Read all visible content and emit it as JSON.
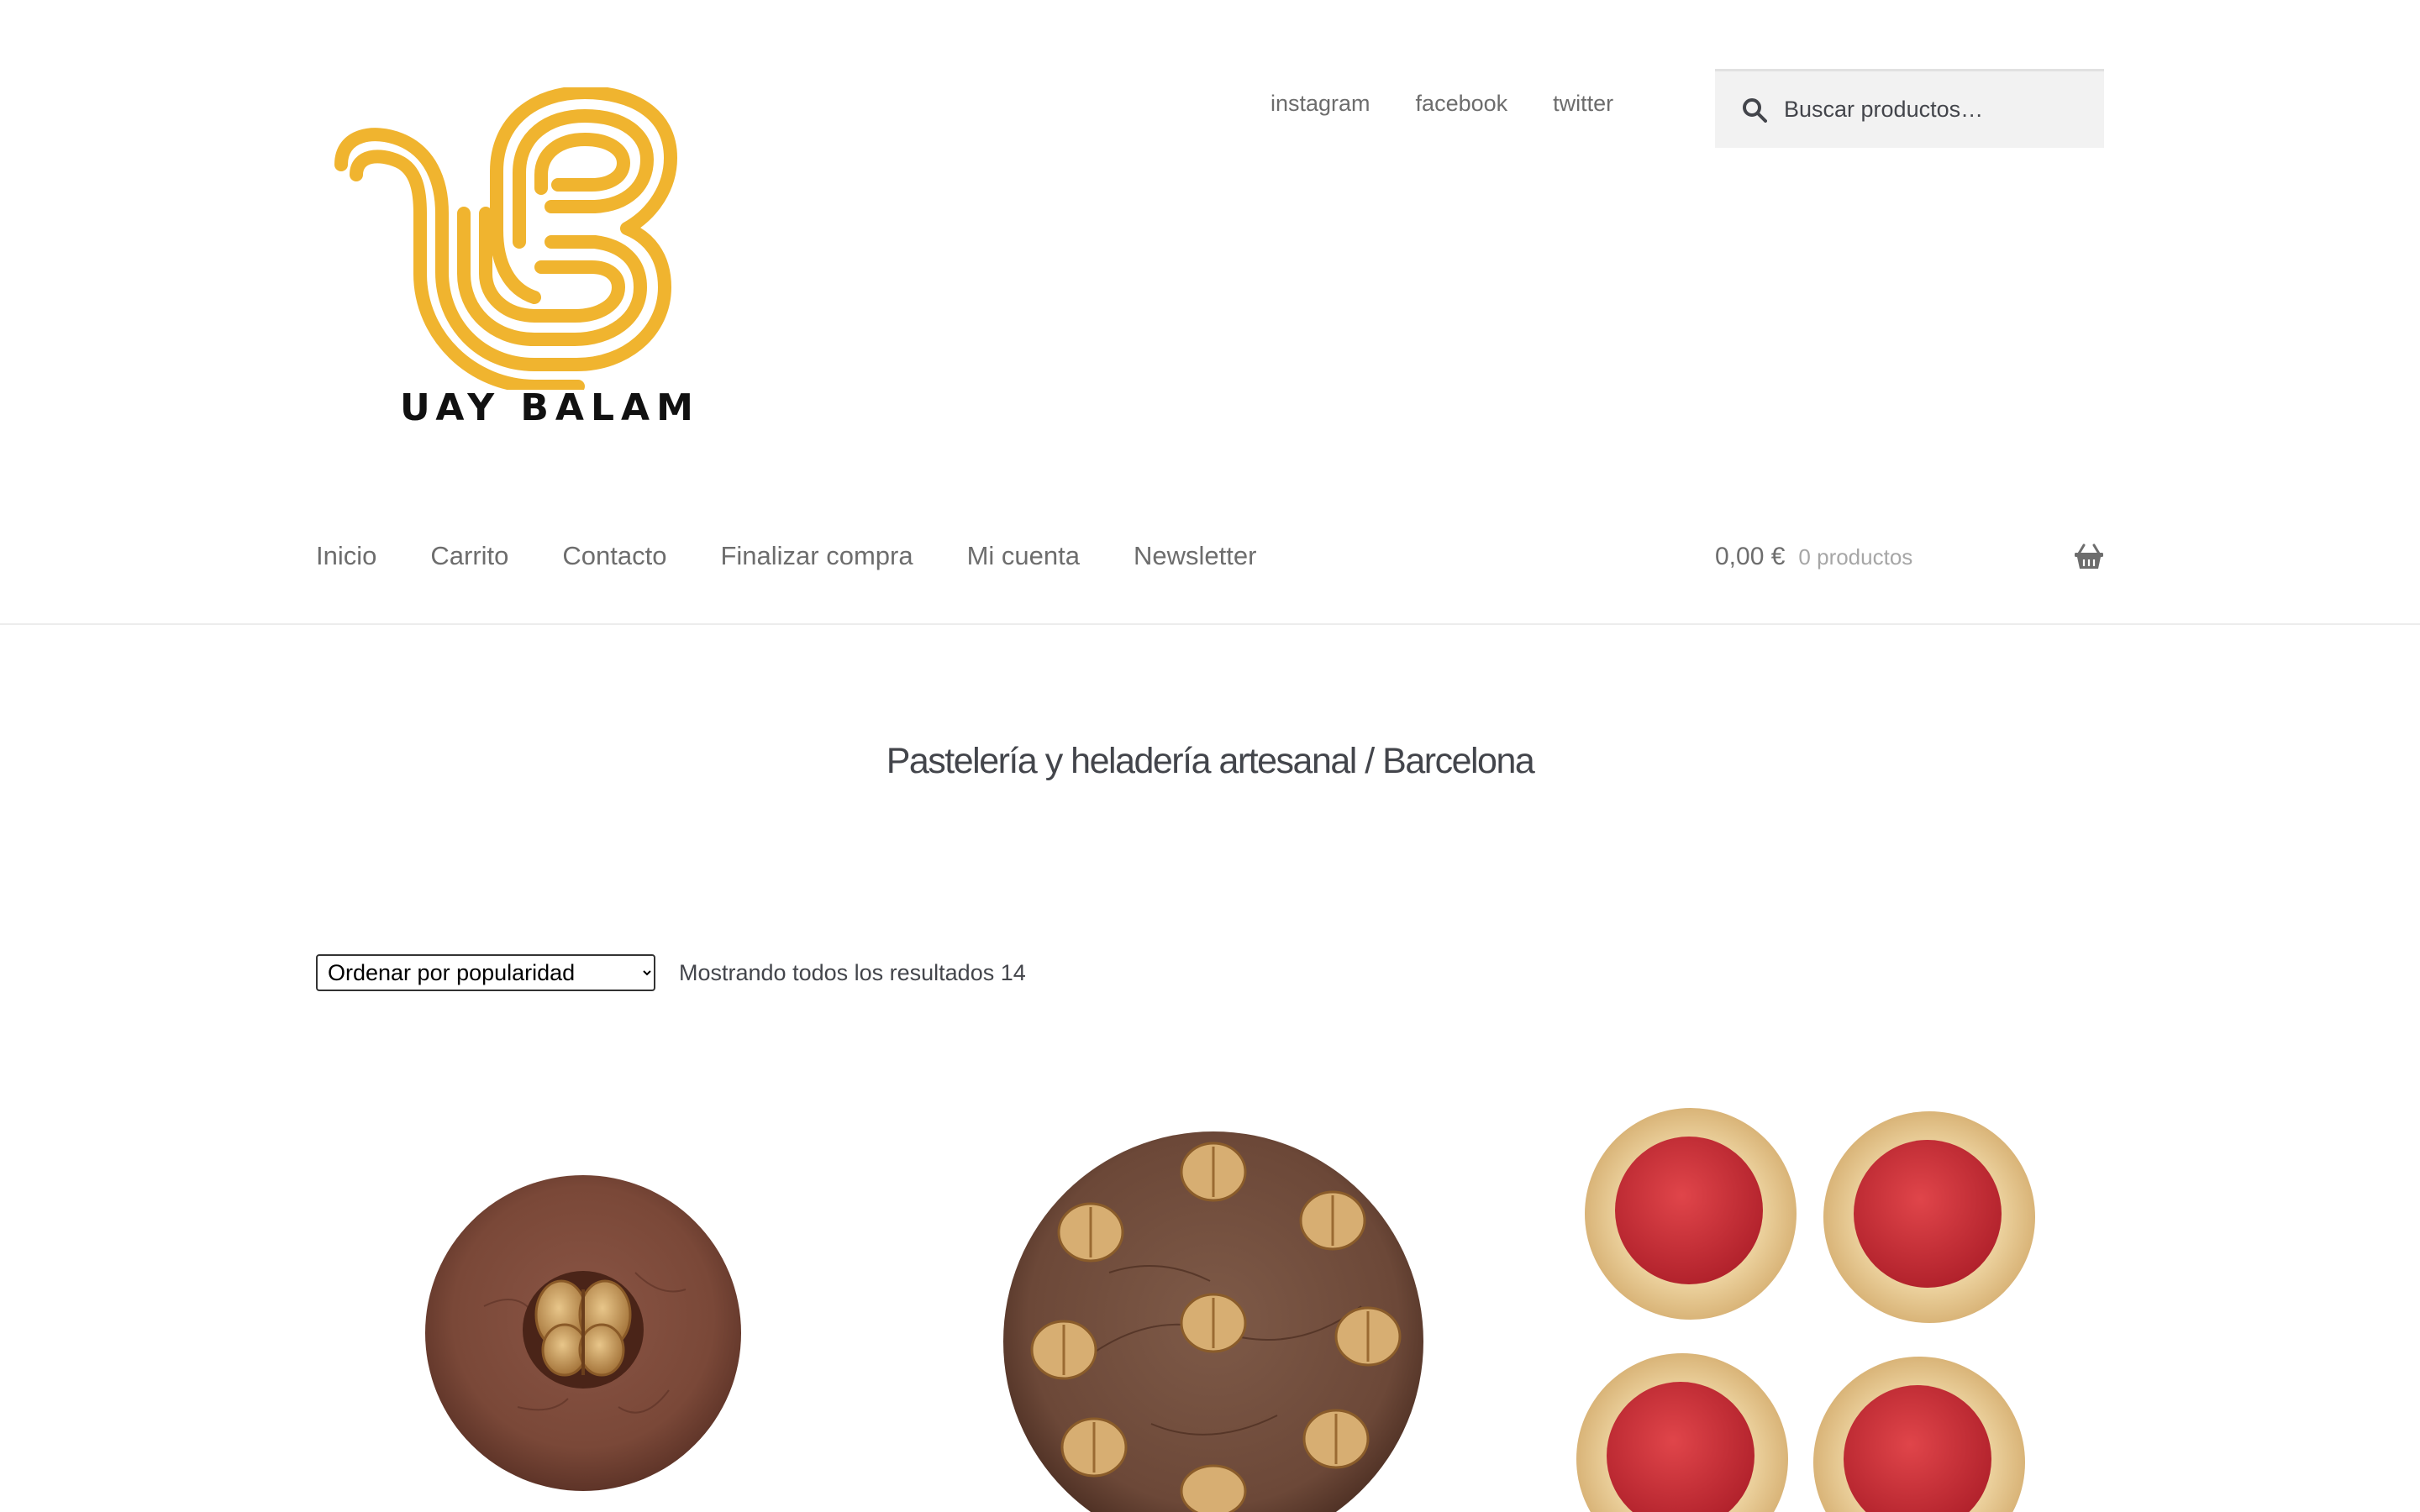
{
  "logo": {
    "wordmark": "UAY BALAM",
    "color": "#F0B42F"
  },
  "social_links": [
    "instagram",
    "facebook",
    "twitter"
  ],
  "search": {
    "placeholder": "Buscar productos…",
    "icon": "search-icon"
  },
  "main_nav": [
    "Inicio",
    "Carrito",
    "Contacto",
    "Finalizar compra",
    "Mi cuenta",
    "Newsletter"
  ],
  "cart": {
    "amount": "0,00 €",
    "count": "0 productos",
    "icon": "basket-icon"
  },
  "tagline": "Pastelería y heladería artesanal / Barcelona",
  "ordering": {
    "selected": "Ordenar por popularidad"
  },
  "result_count": "Mostrando todos los resultados 14",
  "products": [
    {
      "image": "chocolate-cookie-with-walnut"
    },
    {
      "image": "chocolate-brownie-cake-with-walnuts"
    },
    {
      "image": "jam-tart-cookies"
    }
  ]
}
